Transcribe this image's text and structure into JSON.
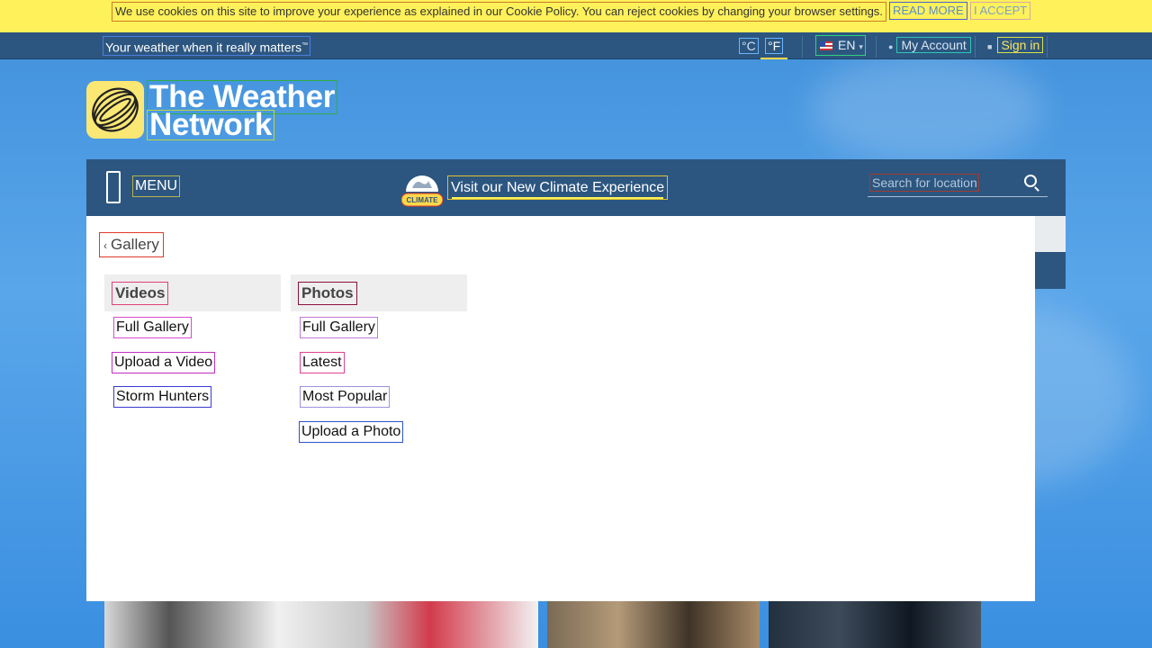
{
  "cookie_bar": {
    "message": "We use cookies on this site to improve your experience as explained in our Cookie Policy. You can reject cookies by changing your browser settings.",
    "read_more": "READ MORE",
    "accept": "I ACCEPT"
  },
  "top_bar": {
    "tagline": "Your weather when it really matters",
    "tagline_mark": "™",
    "unit_c": "°C",
    "unit_f": "°F",
    "language": "EN",
    "account_label": "My Account",
    "signin_label": "Sign in"
  },
  "logo": {
    "line1": "The Weather",
    "line2": "Network"
  },
  "main_nav": {
    "menu_label": "MENU",
    "climate_badge": "CLIMATE",
    "climate_link": "Visit our New Climate Experience",
    "search_placeholder": "Search for location"
  },
  "gallery_menu": {
    "title": "Gallery",
    "videos": {
      "heading": "Videos",
      "links": [
        "Full Gallery",
        "Upload a Video",
        "Storm Hunters"
      ]
    },
    "photos": {
      "heading": "Photos",
      "links": [
        "Full Gallery",
        "Latest",
        "Most Popular",
        "Upload a Photo"
      ]
    }
  },
  "colors": {
    "cookie_bg": "#fff159",
    "nav_bg": "#2c5680",
    "accent_yellow": "#ffd84a",
    "panel_bg": "#ffffff"
  },
  "icons": [
    "flag-us-icon",
    "user-icon",
    "lock-icon",
    "chevron-down-icon",
    "hamburger-icon",
    "globe-climate-icon",
    "search-icon",
    "chevron-left-icon",
    "logo-swirl-icon"
  ]
}
